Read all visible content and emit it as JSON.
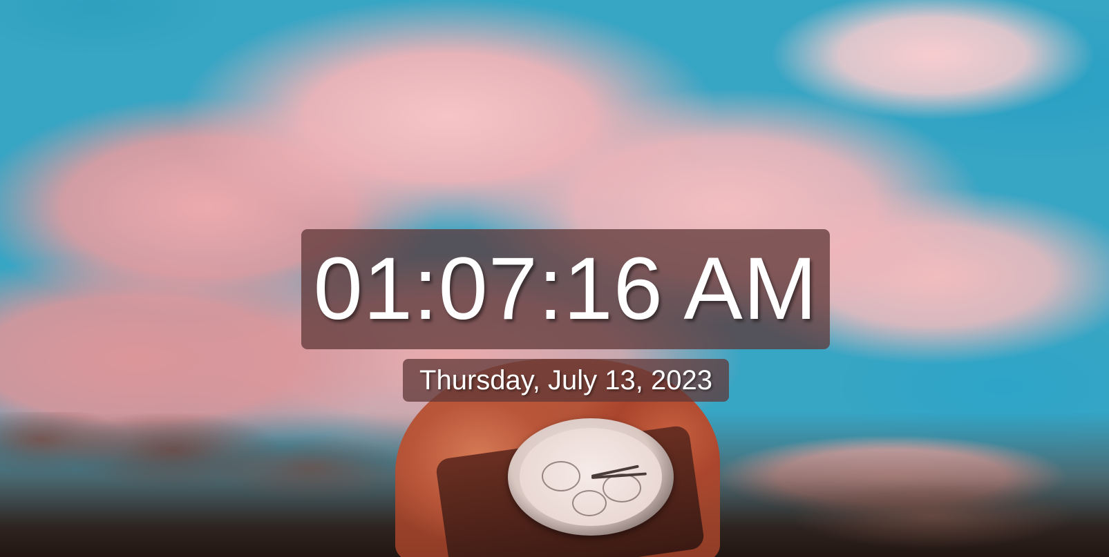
{
  "clock": {
    "time": "01:07:16 AM",
    "date": "Thursday, July 13, 2023"
  },
  "background": {
    "description_icon": "photo-wristwatch-sky"
  },
  "colors": {
    "overlay_box": "#5f3737",
    "text": "#ffffff",
    "sky": "#37a5c4",
    "cloud": "#f0b4b8"
  }
}
